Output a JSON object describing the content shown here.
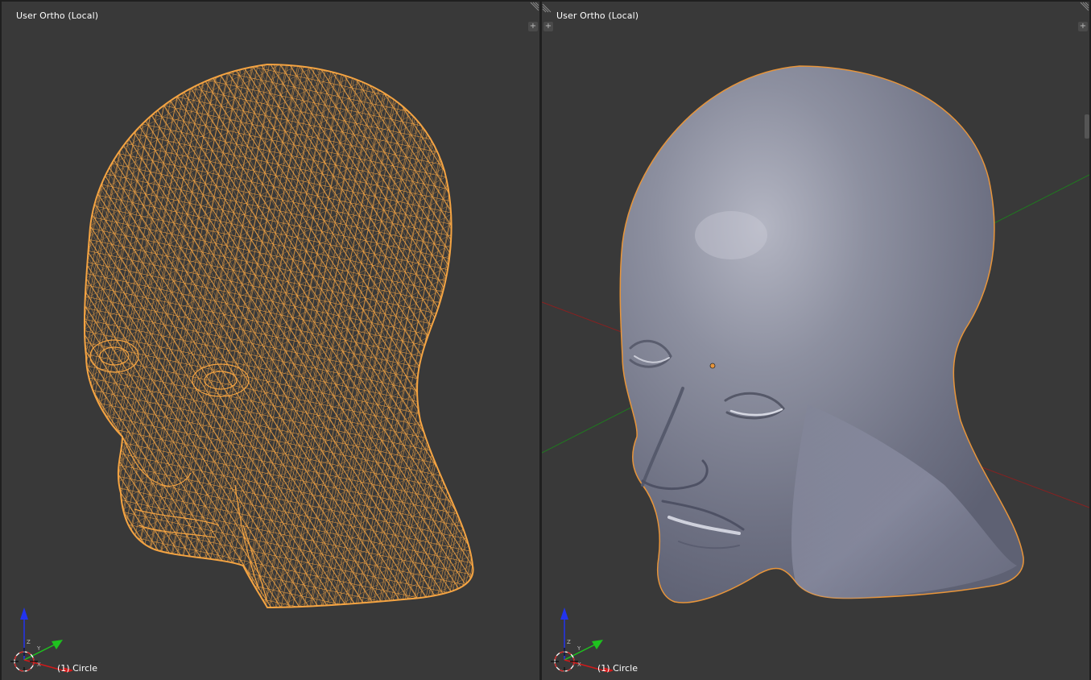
{
  "viewports": [
    {
      "view_label": "User Ortho (Local)",
      "object_label": "(1) Circle",
      "shading": "wireframe"
    },
    {
      "view_label": "User Ortho (Local)",
      "object_label": "(1) Circle",
      "shading": "solid"
    }
  ],
  "colors": {
    "viewport_bg": "#393939",
    "wire": "#f5a442",
    "selection_outline": "#e8953a",
    "surface": "#8a8d9e",
    "axis_x": "#d11a1a",
    "axis_y": "#1ec21e",
    "axis_z": "#2233ee",
    "floor_x_line": "#8a2020",
    "floor_y_line": "#1f7a1f"
  },
  "icons": {
    "corner_add": "plus-icon",
    "corner_split": "hatch-icon",
    "gizmo": "axis-gizmo-icon",
    "cursor": "3d-cursor-icon"
  }
}
